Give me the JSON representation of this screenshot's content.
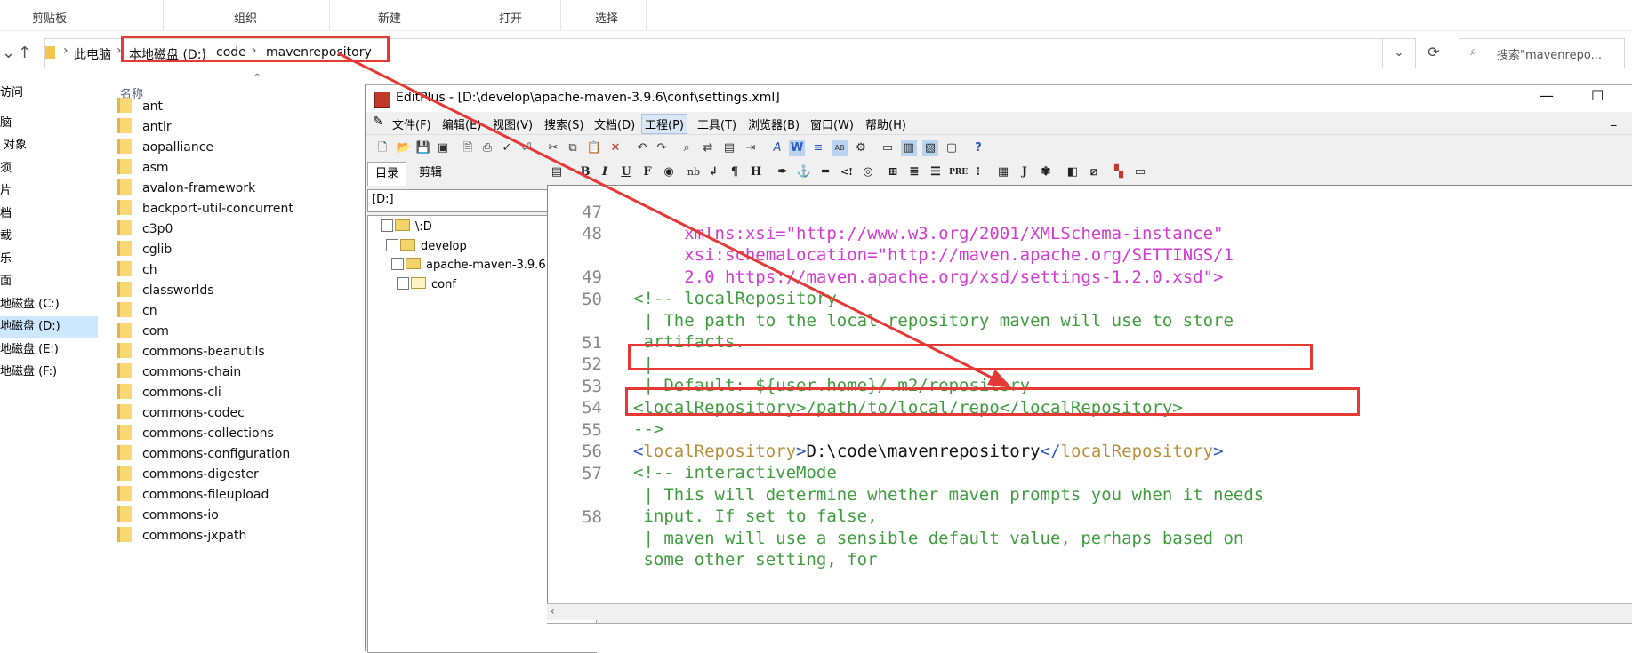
{
  "explorer": {
    "ribbon_groups": [
      "剪贴板",
      "组织",
      "新建",
      "打开",
      "选择"
    ],
    "nav_buttons": {
      "up_arrow": "↑",
      "dropdown": "⌄",
      "refresh": "⟳"
    },
    "breadcrumbs": [
      "此电脑",
      "本地磁盘 (D:)",
      "code",
      "mavenrepository"
    ],
    "search_placeholder": "搜索\"mavenrepo...",
    "nav_items": [
      "访问",
      "脑",
      "对象",
      "须",
      "片",
      "档",
      "载",
      "乐",
      "面",
      "地磁盘 (C:)",
      "地磁盘 (D:)",
      "地磁盘 (E:)",
      "地磁盘 (F:)"
    ],
    "column_header": "名称",
    "folders": [
      "ant",
      "antlr",
      "aopalliance",
      "asm",
      "avalon-framework",
      "backport-util-concurrent",
      "c3p0",
      "cglib",
      "ch",
      "classworlds",
      "cn",
      "com",
      "commons-beanutils",
      "commons-chain",
      "commons-cli",
      "commons-codec",
      "commons-collections",
      "commons-configuration",
      "commons-digester",
      "commons-fileupload",
      "commons-io",
      "commons-jxpath"
    ]
  },
  "editplus": {
    "title": "EditPlus - [D:\\develop\\apache-maven-3.9.6\\conf\\settings.xml]",
    "menu": [
      "文件(F)",
      "编辑(E)",
      "视图(V)",
      "搜索(S)",
      "文档(D)",
      "工程(P)",
      "工具(T)",
      "浏览器(B)",
      "窗口(W)",
      "帮助(H)"
    ],
    "left_tabs": [
      "目录",
      "剪辑"
    ],
    "drive": "[D:]",
    "tree": [
      "\\:D",
      "develop",
      "apache-maven-3.9.6",
      "conf"
    ],
    "code_lines": [
      {
        "n": "47",
        "text": "     xmlns:xsi=\"http://www.w3.org/2001/XMLSchema-instance\""
      },
      {
        "n": "48",
        "text": "     xsi:schemaLocation=\"http://maven.apache.org/SETTINGS/1"
      },
      {
        "n": "",
        "text": "     2.0 https://maven.apache.org/xsd/settings-1.2.0.xsd\">"
      },
      {
        "n": "49",
        "text": "<!-- localRepository"
      },
      {
        "n": "50",
        "text": " | The path to the local repository maven will use to store"
      },
      {
        "n": "",
        "text": " artifacts."
      },
      {
        "n": "51",
        "text": " |"
      },
      {
        "n": "52",
        "text": " | Default: ${user.home}/.m2/repository"
      },
      {
        "n": "53",
        "text": "<localRepository>/path/to/local/repo</localRepository>"
      },
      {
        "n": "54",
        "text": "-->"
      },
      {
        "n": "55",
        "text": "<localRepository>D:\\code\\mavenrepository</localRepository>"
      },
      {
        "n": "56",
        "text": "<!-- interactiveMode"
      },
      {
        "n": "57",
        "text": " | This will determine whether maven prompts you when it needs"
      },
      {
        "n": "",
        "text": " input. If set to false,"
      },
      {
        "n": "58",
        "text": " | maven will use a sensible default value, perhaps based on"
      },
      {
        "n": "",
        "text": " some other setting, for"
      }
    ]
  },
  "colors": {
    "annotation_red": "#e53935",
    "comment_green": "#3f9d3f",
    "tag_blue": "#2b58c2",
    "string_magenta": "#d33bd3"
  }
}
